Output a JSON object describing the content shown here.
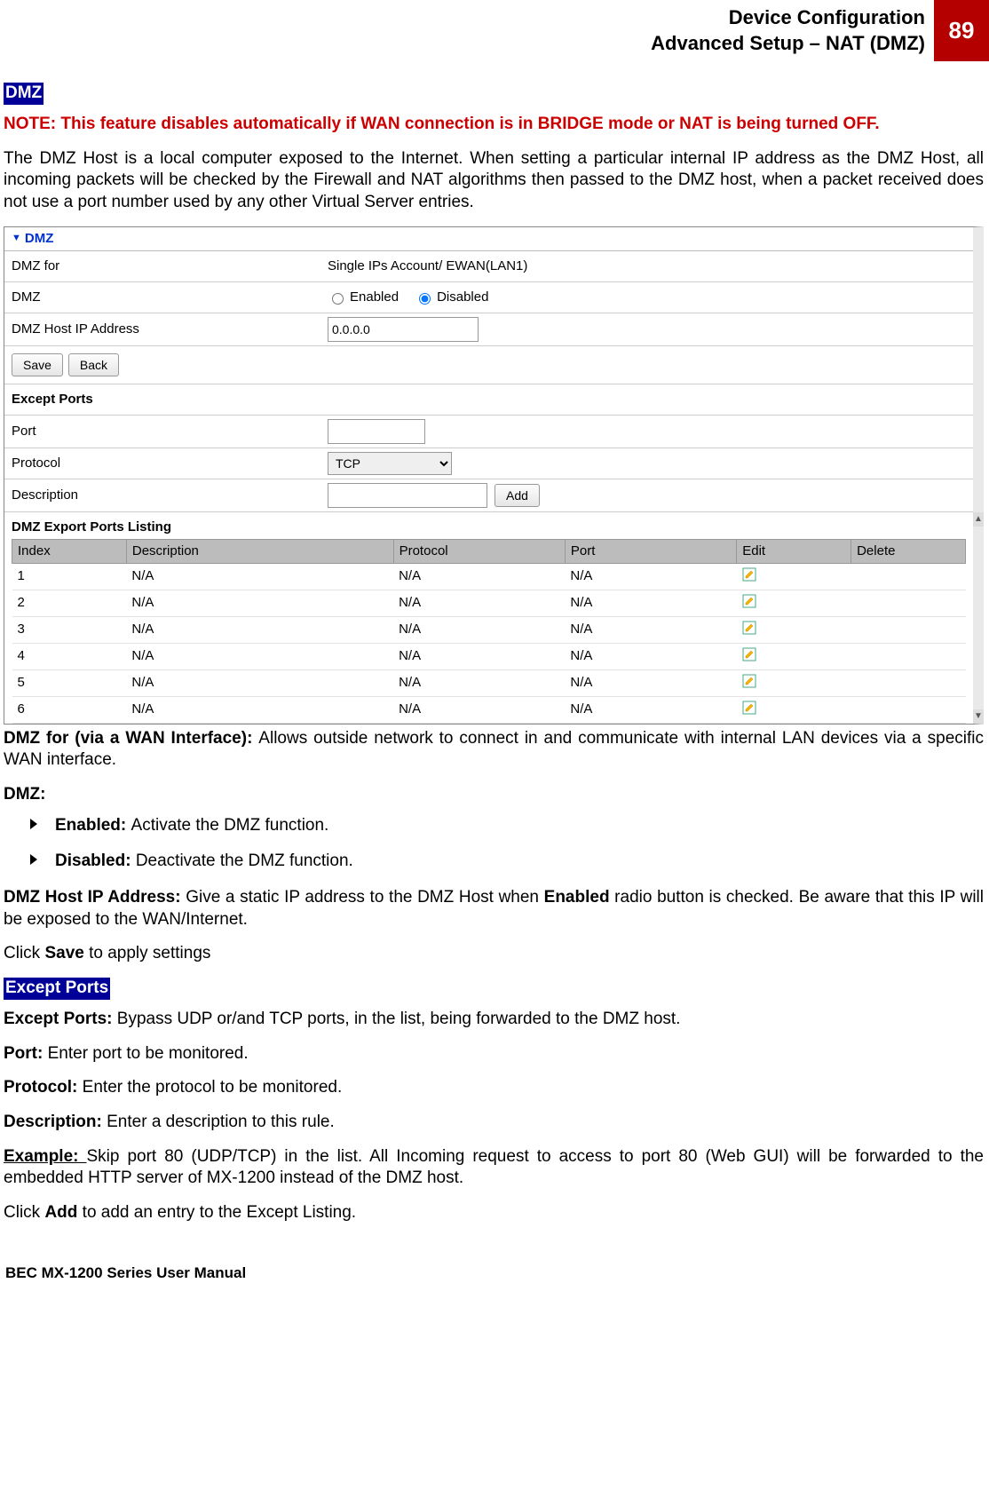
{
  "header": {
    "line1": "Device Configuration",
    "line2": "Advanced Setup – NAT (DMZ)",
    "page": "89"
  },
  "sections": {
    "dmz_badge": "DMZ",
    "except_badge": "Except Ports"
  },
  "note": "NOTE: This feature disables automatically if WAN connection is in BRIDGE mode or NAT is being turned OFF.",
  "intro": "The DMZ Host is a local computer exposed to the Internet. When setting a particular internal IP address as the DMZ Host, all incoming packets will be checked by the Firewall and NAT algorithms then passed to the DMZ host, when a packet received does not use a port number used by any other Virtual Server entries.",
  "ui": {
    "section_title": "DMZ",
    "rows": {
      "dmz_for_label": "DMZ for",
      "dmz_for_value": "Single IPs Account/ EWAN(LAN1)",
      "dmz_label": "DMZ",
      "enabled": "Enabled",
      "disabled": "Disabled",
      "host_label": "DMZ Host IP Address",
      "host_value": "0.0.0.0"
    },
    "buttons": {
      "save": "Save",
      "back": "Back",
      "add": "Add"
    },
    "except_title": "Except Ports",
    "except": {
      "port_label": "Port",
      "port_value": "",
      "protocol_label": "Protocol",
      "protocol_value": "TCP",
      "desc_label": "Description",
      "desc_value": ""
    },
    "listing_title": "DMZ Export Ports Listing",
    "listing_headers": {
      "index": "Index",
      "desc": "Description",
      "proto": "Protocol",
      "port": "Port",
      "edit": "Edit",
      "del": "Delete"
    },
    "listing_rows": [
      {
        "index": "1",
        "desc": "N/A",
        "proto": "N/A",
        "port": "N/A"
      },
      {
        "index": "2",
        "desc": "N/A",
        "proto": "N/A",
        "port": "N/A"
      },
      {
        "index": "3",
        "desc": "N/A",
        "proto": "N/A",
        "port": "N/A"
      },
      {
        "index": "4",
        "desc": "N/A",
        "proto": "N/A",
        "port": "N/A"
      },
      {
        "index": "5",
        "desc": "N/A",
        "proto": "N/A",
        "port": "N/A"
      },
      {
        "index": "6",
        "desc": "N/A",
        "proto": "N/A",
        "port": "N/A"
      }
    ]
  },
  "desc": {
    "dmz_for_b": "DMZ for (via a WAN Interface): ",
    "dmz_for_t": "Allows outside network to connect in and communicate with internal LAN devices via a specific WAN interface.",
    "dmz_b": "DMZ:",
    "enabled_b": "Enabled: ",
    "enabled_t": "Activate the DMZ function.",
    "disabled_b": "Disabled: ",
    "disabled_t": "Deactivate the DMZ function.",
    "host_b": "DMZ Host IP Address: ",
    "host_t1": "Give a static IP address to the DMZ Host when ",
    "host_t_extra": "Enabled",
    "host_t2": " radio button is checked. Be aware that this IP will be exposed to the WAN/Internet.",
    "save_t1": "Click ",
    "save_b": "Save",
    "save_t2": " to apply settings",
    "except_b": "Except Ports: ",
    "except_t": "Bypass UDP or/and TCP ports, in the list, being forwarded to the DMZ host.",
    "port_b": "Port: ",
    "port_t": "Enter port to be monitored.",
    "proto_b": "Protocol: ",
    "proto_t": "Enter the protocol to be monitored.",
    "descr_b": "Description: ",
    "descr_t": "Enter a description to this rule.",
    "ex_b": "Example: ",
    "ex_t": "Skip port 80 (UDP/TCP) in the list.  All Incoming request to access to port 80 (Web GUI) will be forwarded to the embedded HTTP server of MX-1200 instead of the DMZ host.",
    "add_t1": "Click ",
    "add_b": "Add",
    "add_t2": " to add an entry to the Except Listing."
  },
  "footer": "BEC MX-1200 Series User Manual"
}
